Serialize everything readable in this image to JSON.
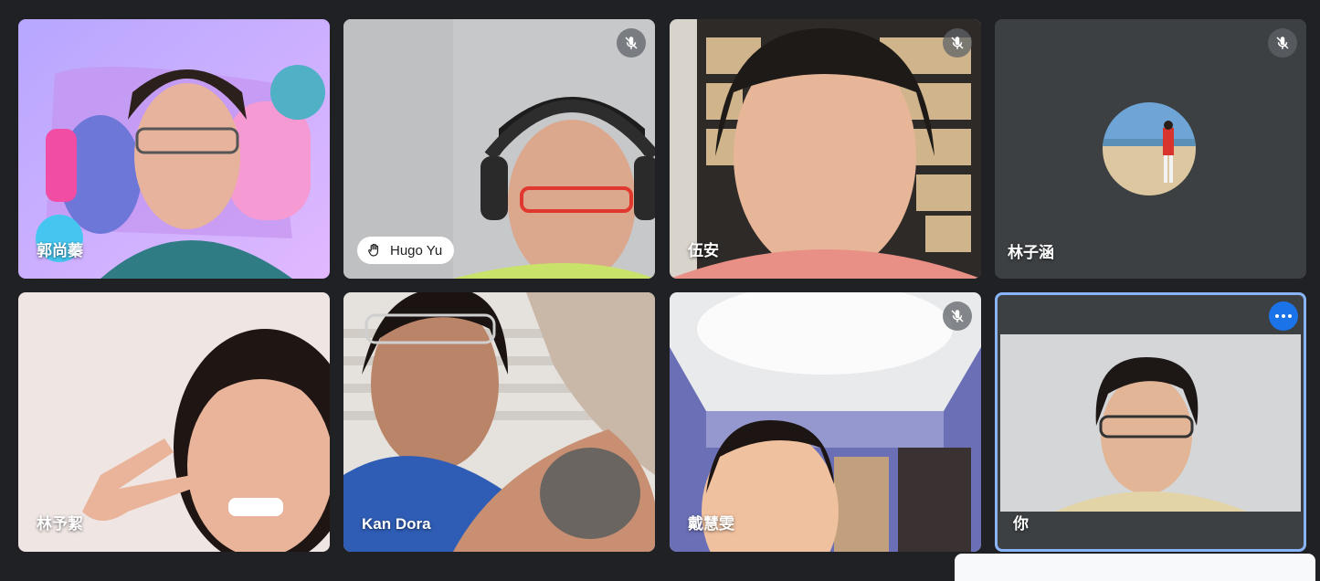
{
  "participants": [
    {
      "name": "郭尚蓁",
      "muted": false
    },
    {
      "name": "Hugo Yu",
      "muted": true,
      "hand_raised": true
    },
    {
      "name": "伍安",
      "muted": true
    },
    {
      "name": "林子涵",
      "muted": true,
      "camera_off": true
    },
    {
      "name": "林予絜",
      "muted": false
    },
    {
      "name": "Kan Dora",
      "muted": false
    },
    {
      "name": "戴慧雯",
      "muted": true
    },
    {
      "name": "你",
      "muted": false,
      "is_self": true
    }
  ],
  "icons": {
    "mute": "mic-off-icon",
    "hand": "raised-hand-icon",
    "more": "more-options-icon"
  },
  "colors": {
    "background": "#202124",
    "self_border": "#8ab4f8",
    "more_button": "#1a73e8"
  }
}
